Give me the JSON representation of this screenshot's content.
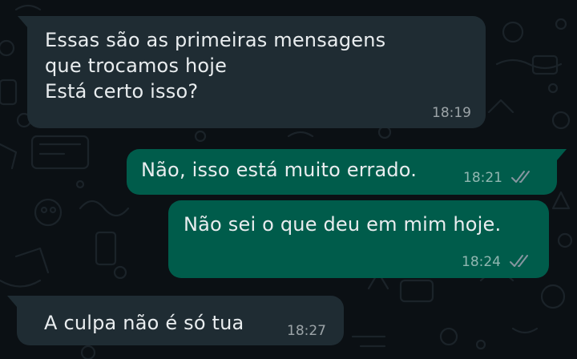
{
  "colors": {
    "background": "#0b1014",
    "incoming_bubble": "#1f2c33",
    "outgoing_bubble": "#005c4b",
    "text": "#e9edef",
    "read_ticks": "#8696a0"
  },
  "messages": [
    {
      "direction": "incoming",
      "text": "Essas são as primeiras mensagens\nque trocamos hoje\nEstá certo isso?",
      "time": "18:19"
    },
    {
      "direction": "outgoing",
      "text": "Não, isso está muito errado.",
      "time": "18:21",
      "status_icon": "double-check-icon"
    },
    {
      "direction": "outgoing",
      "text": "Não sei o que deu em mim hoje.",
      "time": "18:24",
      "status_icon": "double-check-icon"
    },
    {
      "direction": "incoming",
      "text": "A culpa não é só tua",
      "time": "18:27"
    }
  ]
}
